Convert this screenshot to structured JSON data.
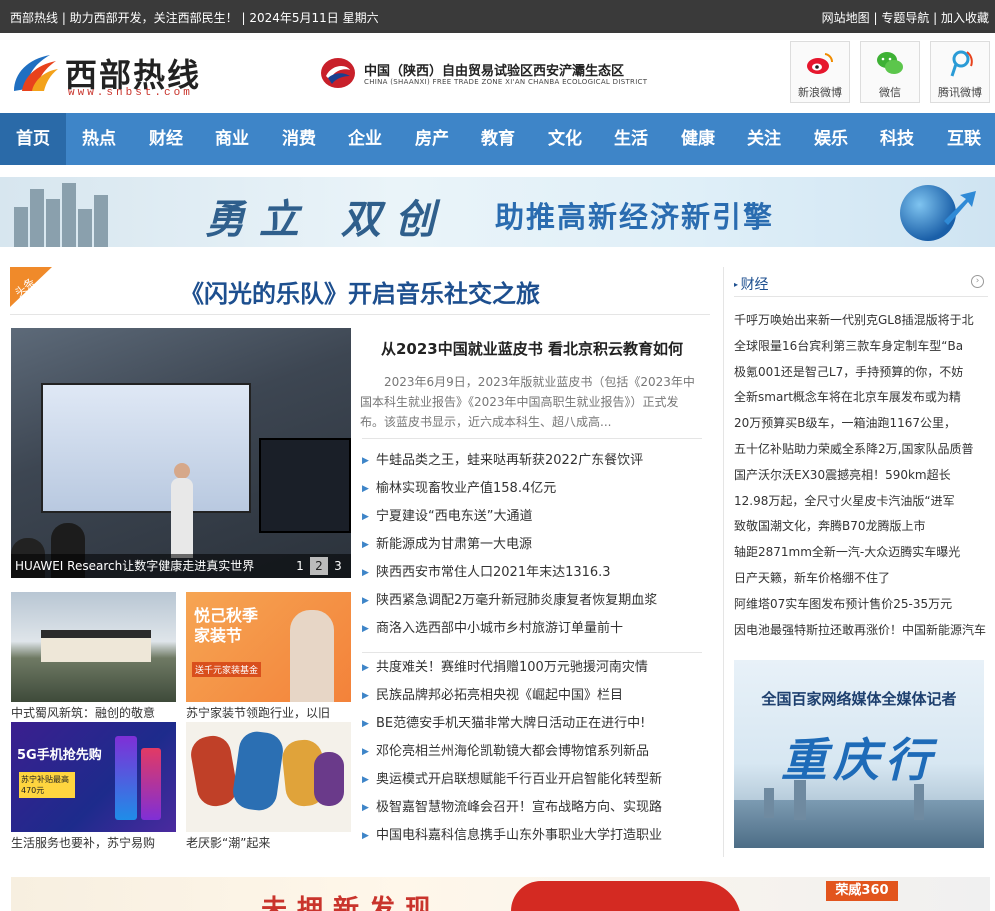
{
  "topbar": {
    "left": "西部热线 | 助力西部开发，关注西部民生！ | 2024年5月11日 星期六",
    "right": "网站地图 | 专题导航 | 加入收藏"
  },
  "logo": {
    "title": "西部热线",
    "url": "www.snbst.com"
  },
  "ftz": {
    "cn": "中国（陕西）自由贸易试验区西安浐灞生态区",
    "en": "CHINA (SHAANXI) FREE TRADE ZONE XI'AN CHANBA ECOLOGICAL DISTRICT"
  },
  "social": [
    {
      "label": "新浪微博",
      "icon": "weibo-icon"
    },
    {
      "label": "微信",
      "icon": "wechat-icon"
    },
    {
      "label": "腾讯微博",
      "icon": "tencent-weibo-icon"
    }
  ],
  "nav": [
    "首页",
    "热点",
    "财经",
    "商业",
    "消费",
    "企业",
    "房产",
    "教育",
    "文化",
    "生活",
    "健康",
    "关注",
    "娱乐",
    "科技",
    "互联"
  ],
  "banner": {
    "t1": "勇立 双创",
    "t2": "助推高新经济新引擎"
  },
  "headline": {
    "tag": "头条",
    "title": "《闪光的乐队》开启音乐社交之旅"
  },
  "slide": {
    "caption": "HUAWEI Research让数字健康走进真实世界",
    "pages": [
      "1",
      "2",
      "3"
    ]
  },
  "lead": {
    "title": "从2023中国就业蓝皮书 看北京积云教育如何",
    "body": "2023年6月9日，2023年版就业蓝皮书（包括《2023年中国本科生就业报告》《2023年中国高职生就业报告》）正式发布。该蓝皮书显示，近六成本科生、超八成高..."
  },
  "news1": [
    "牛蛙品类之王，蛙来哒再斩获2022广东餐饮评",
    "榆林实现畜牧业产值158.4亿元",
    "宁夏建设“西电东送”大通道",
    "新能源成为甘肃第一大电源",
    "陕西西安市常住人口2021年末达1316.3",
    "陕西紧急调配2万毫升新冠肺炎康复者恢复期血浆",
    "商洛入选西部中小城市乡村旅游订单量前十"
  ],
  "news2": [
    "共度难关！赛维时代捐赠100万元驰援河南灾情",
    "民族品牌邦必拓亮相央视《崛起中国》栏目",
    "BE范德安手机天猫非常大牌日活动正在进行中!",
    "邓伦亮相兰州海伦凯勒镜大都会博物馆系列新品",
    "奥运模式开启联想赋能千行百业开启智能化转型新",
    "极智嘉智慧物流峰会召开！宣布战略方向、实现路",
    "中国电科嘉科信息携手山东外事职业大学打造职业"
  ],
  "thumbs": [
    {
      "caption": "中式蜀风新筑：融创的敬意"
    },
    {
      "caption": "苏宁家装节领跑行业，以旧"
    },
    {
      "caption": "生活服务也要补，苏宁易购"
    },
    {
      "caption": "老厌影“潮”起来"
    }
  ],
  "thumb_text": {
    "suning_title": "悦己秋季家装节",
    "suning_sub": "送千元家装基金",
    "phone_title": "5G手机抢先购",
    "phone_sub": "苏宁补贴最高470元"
  },
  "side": {
    "title": "财经",
    "items": [
      "千呼万唤始出来新一代别克GL8插混版将于北",
      "全球限量16台宾利第三款车身定制车型“Ba",
      "极氪001还是智己L7，手持预算的你，不妨",
      "全新smart概念车将在北京车展发布或为精",
      "20万预算买B级车，一箱油跑1167公里，",
      "五十亿补贴助力荣威全系降2万,国家队品质普",
      "国产沃尔沃EX30震撼亮相！590km超长",
      "12.98万起，全尺寸火星皮卡汽油版“进军",
      "致敬国潮文化，奔腾B70龙腾版上市",
      "轴距2871mm全新一汽-大众迈腾实车曝光",
      "日产天籁，新车价格绷不住了",
      "阿维塔07实车图发布预计售价25-35万元",
      "因电池最强特斯拉还敢再涨价！中国新能源汽车"
    ],
    "ad_line1": "全国百家网络媒体全媒体记者",
    "ad_line2": "重庆行"
  },
  "bottom_ad": {
    "text": "未拥新发现",
    "brand": "荣威360"
  }
}
